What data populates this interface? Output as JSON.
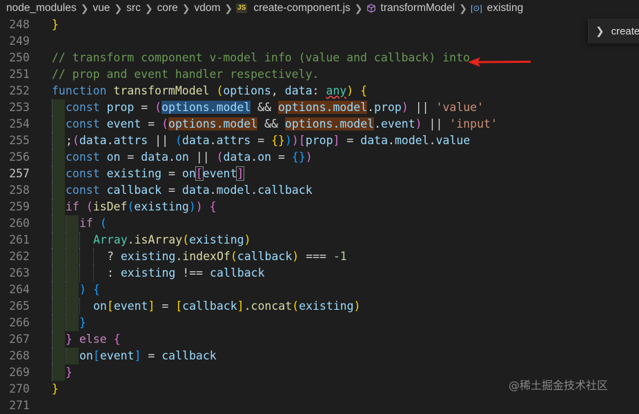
{
  "breadcrumb": {
    "items": [
      "node_modules",
      "vue",
      "src",
      "core",
      "vdom"
    ],
    "file_badge": "JS",
    "file": "create-component.js",
    "symbol": "transformModel",
    "field": "existing"
  },
  "sticky": {
    "label": "create"
  },
  "watermark": "@稀土掘金技术社区",
  "editor": {
    "active_line": 257,
    "lines": [
      {
        "n": 248,
        "guides": 0,
        "t": [
          [
            "}",
            "b1"
          ]
        ]
      },
      {
        "n": 249,
        "guides": 0,
        "t": []
      },
      {
        "n": 250,
        "guides": 0,
        "t": [
          [
            "// transform component v-model info (value and callback) into",
            "cm"
          ]
        ]
      },
      {
        "n": 251,
        "guides": 0,
        "t": [
          [
            "// prop and event handler respectively.",
            "cm"
          ]
        ]
      },
      {
        "n": 252,
        "guides": 0,
        "t": [
          [
            "function",
            "kw"
          ],
          [
            " "
          ],
          [
            "transformModel",
            "fn"
          ],
          [
            " "
          ],
          [
            "(",
            "b1"
          ],
          [
            "options",
            "vr"
          ],
          [
            ", "
          ],
          [
            "data",
            "vr"
          ],
          [
            ": "
          ],
          [
            "any",
            "ty squig"
          ],
          [
            ")",
            "b1"
          ],
          [
            " "
          ],
          [
            "{",
            "b1"
          ]
        ]
      },
      {
        "n": 253,
        "guides": 1,
        "t": [
          [
            "const",
            "kw"
          ],
          [
            " "
          ],
          [
            "prop",
            "vr"
          ],
          [
            " = "
          ],
          [
            "(",
            "b2"
          ],
          [
            "options.model",
            "vr sel"
          ],
          [
            " && "
          ],
          [
            "options.model",
            "vr hl"
          ],
          [
            "."
          ],
          [
            "prop",
            "vr"
          ],
          [
            ")",
            "b2"
          ],
          [
            " || "
          ],
          [
            "'value'",
            "str"
          ]
        ]
      },
      {
        "n": 254,
        "guides": 1,
        "t": [
          [
            "const",
            "kw"
          ],
          [
            " "
          ],
          [
            "event",
            "vr"
          ],
          [
            " = "
          ],
          [
            "(",
            "b2"
          ],
          [
            "options.model",
            "vr hl"
          ],
          [
            " && "
          ],
          [
            "options.model",
            "vr hl"
          ],
          [
            "."
          ],
          [
            "event",
            "vr"
          ],
          [
            ")",
            "b2"
          ],
          [
            " || "
          ],
          [
            "'input'",
            "str"
          ]
        ]
      },
      {
        "n": 255,
        "guides": 1,
        "t": [
          [
            ";"
          ],
          [
            "(",
            "b2"
          ],
          [
            "data",
            "vr"
          ],
          [
            "."
          ],
          [
            "attrs",
            "vr"
          ],
          [
            " || "
          ],
          [
            "(",
            "b3"
          ],
          [
            "data",
            "vr"
          ],
          [
            "."
          ],
          [
            "attrs",
            "vr"
          ],
          [
            " = "
          ],
          [
            "{}",
            "b1"
          ],
          [
            ")",
            "b3"
          ],
          [
            ")",
            "b2"
          ],
          [
            "[",
            "b2"
          ],
          [
            "prop",
            "vr"
          ],
          [
            "]",
            "b2"
          ],
          [
            " = "
          ],
          [
            "data",
            "vr"
          ],
          [
            "."
          ],
          [
            "model",
            "vr"
          ],
          [
            "."
          ],
          [
            "value",
            "vr"
          ]
        ]
      },
      {
        "n": 256,
        "guides": 1,
        "t": [
          [
            "const",
            "kw"
          ],
          [
            " "
          ],
          [
            "on",
            "vr"
          ],
          [
            " = "
          ],
          [
            "data",
            "vr"
          ],
          [
            "."
          ],
          [
            "on",
            "vr"
          ],
          [
            " || "
          ],
          [
            "(",
            "b2"
          ],
          [
            "data",
            "vr"
          ],
          [
            "."
          ],
          [
            "on",
            "vr"
          ],
          [
            " = "
          ],
          [
            "{}",
            "b3"
          ],
          [
            ")",
            "b2"
          ]
        ]
      },
      {
        "n": 257,
        "guides": 1,
        "t": [
          [
            "const",
            "kw"
          ],
          [
            " "
          ],
          [
            "existing",
            "vr"
          ],
          [
            " = "
          ],
          [
            "on",
            "vr"
          ],
          [
            "[",
            "b2 box"
          ],
          [
            "event",
            "vr"
          ],
          [
            "]",
            "b2 box"
          ]
        ]
      },
      {
        "n": 258,
        "guides": 1,
        "t": [
          [
            "const",
            "kw"
          ],
          [
            " "
          ],
          [
            "callback",
            "vr"
          ],
          [
            " = "
          ],
          [
            "data",
            "vr"
          ],
          [
            "."
          ],
          [
            "model",
            "vr"
          ],
          [
            "."
          ],
          [
            "callback",
            "vr"
          ]
        ]
      },
      {
        "n": 259,
        "guides": 1,
        "t": [
          [
            "if",
            "kw2"
          ],
          [
            " "
          ],
          [
            "(",
            "b2"
          ],
          [
            "isDef",
            "fn"
          ],
          [
            "(",
            "b3"
          ],
          [
            "existing",
            "vr"
          ],
          [
            ")",
            "b3"
          ],
          [
            ")",
            "b2"
          ],
          [
            " "
          ],
          [
            "{",
            "b2"
          ]
        ]
      },
      {
        "n": 260,
        "guides": 2,
        "t": [
          [
            "if",
            "kw2"
          ],
          [
            " "
          ],
          [
            "(",
            "b3"
          ]
        ]
      },
      {
        "n": 261,
        "guides": 3,
        "t": [
          [
            "Array",
            "ty"
          ],
          [
            "."
          ],
          [
            "isArray",
            "fn"
          ],
          [
            "(",
            "b1"
          ],
          [
            "existing",
            "vr"
          ],
          [
            ")",
            "b1"
          ]
        ]
      },
      {
        "n": 262,
        "guides": 4,
        "t": [
          [
            "? "
          ],
          [
            "existing",
            "vr"
          ],
          [
            "."
          ],
          [
            "indexOf",
            "fn"
          ],
          [
            "(",
            "b1"
          ],
          [
            "callback",
            "vr"
          ],
          [
            ")",
            "b1"
          ],
          [
            " === "
          ],
          [
            "-1",
            "num"
          ]
        ]
      },
      {
        "n": 263,
        "guides": 4,
        "t": [
          [
            ": "
          ],
          [
            "existing",
            "vr"
          ],
          [
            " !== "
          ],
          [
            "callback",
            "vr"
          ]
        ]
      },
      {
        "n": 264,
        "guides": 2,
        "t": [
          [
            ")",
            "b3"
          ],
          [
            " "
          ],
          [
            "{",
            "b3"
          ]
        ]
      },
      {
        "n": 265,
        "guides": 3,
        "t": [
          [
            "on",
            "vr"
          ],
          [
            "[",
            "b1"
          ],
          [
            "event",
            "vr"
          ],
          [
            "]",
            "b1"
          ],
          [
            " = "
          ],
          [
            "[",
            "b1"
          ],
          [
            "callback",
            "vr"
          ],
          [
            "]",
            "b1"
          ],
          [
            "."
          ],
          [
            "concat",
            "fn"
          ],
          [
            "(",
            "b1"
          ],
          [
            "existing",
            "vr"
          ],
          [
            ")",
            "b1"
          ]
        ]
      },
      {
        "n": 266,
        "guides": 2,
        "t": [
          [
            "}",
            "b3"
          ]
        ]
      },
      {
        "n": 267,
        "guides": 1,
        "t": [
          [
            "}",
            "b2"
          ],
          [
            " "
          ],
          [
            "else",
            "kw2"
          ],
          [
            " "
          ],
          [
            "{",
            "b2"
          ]
        ]
      },
      {
        "n": 268,
        "guides": 2,
        "t": [
          [
            "on",
            "vr"
          ],
          [
            "[",
            "b3"
          ],
          [
            "event",
            "vr"
          ],
          [
            "]",
            "b3"
          ],
          [
            " = "
          ],
          [
            "callback",
            "vr"
          ]
        ]
      },
      {
        "n": 269,
        "guides": 1,
        "t": [
          [
            "}",
            "b2"
          ]
        ]
      },
      {
        "n": 270,
        "guides": 0,
        "t": [
          [
            "}",
            "b1"
          ]
        ]
      },
      {
        "n": 271,
        "guides": 0,
        "t": []
      }
    ]
  }
}
